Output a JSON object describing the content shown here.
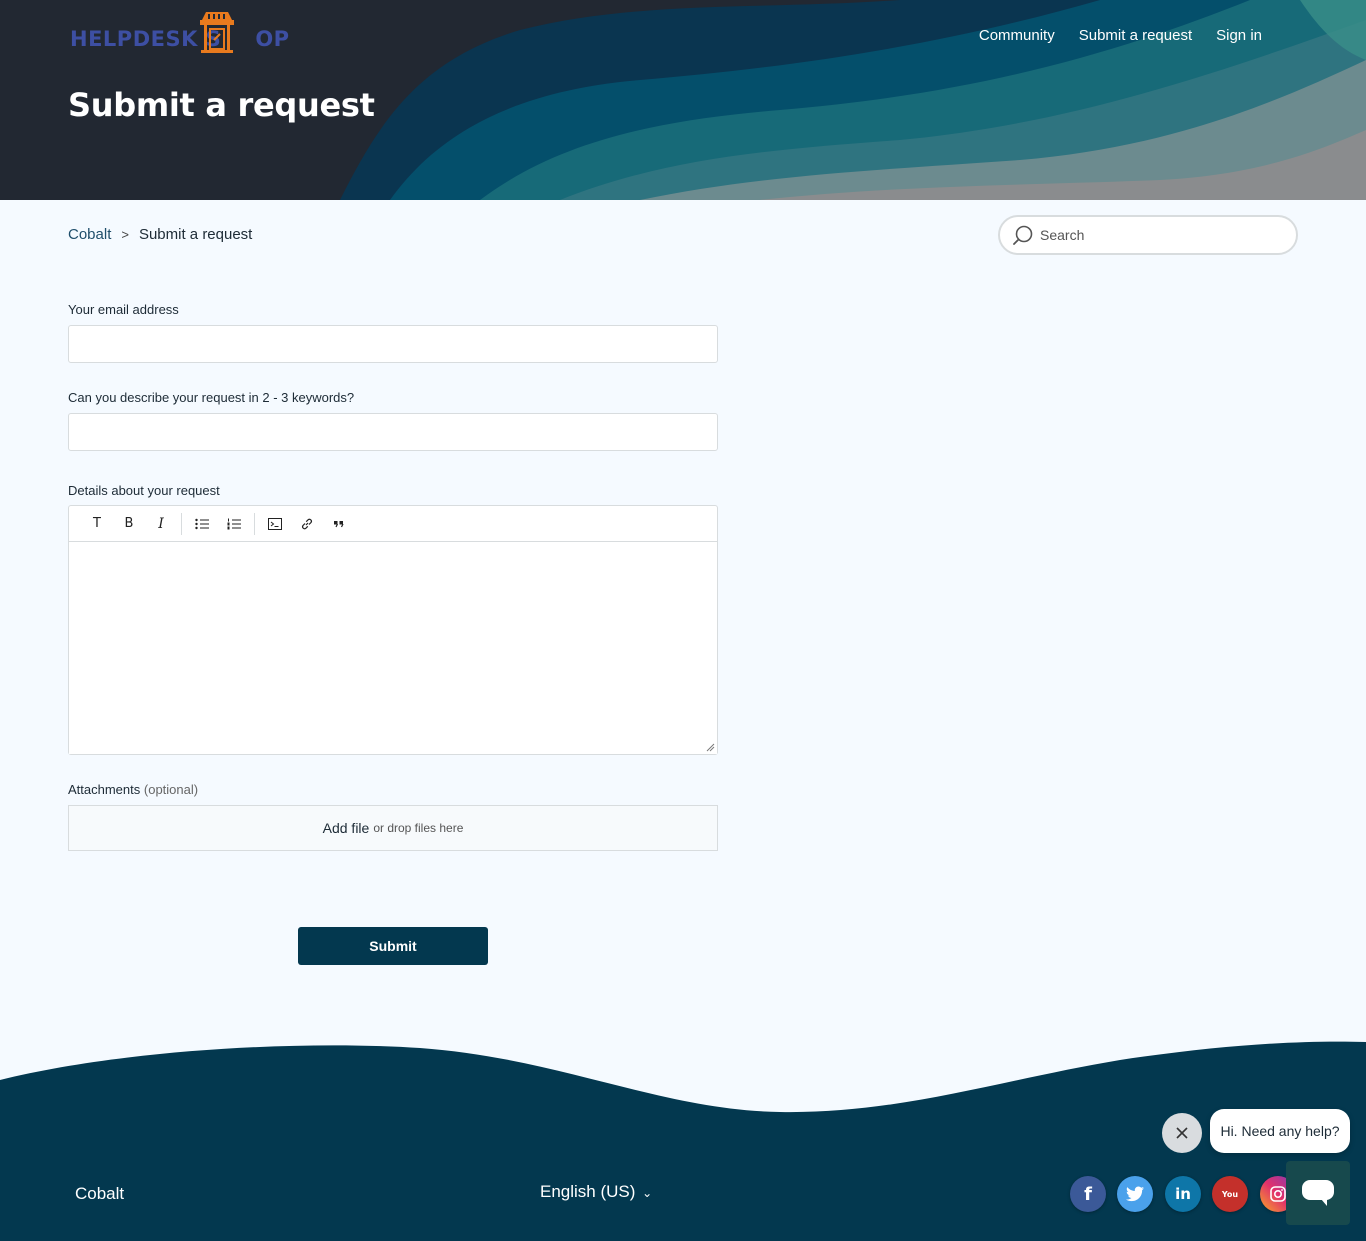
{
  "header": {
    "logo_text_left": "HELPDESK S",
    "logo_text_right": "OP",
    "nav": [
      "Community",
      "Submit a request",
      "Sign in"
    ],
    "title": "Submit a request"
  },
  "breadcrumb": {
    "root": "Cobalt",
    "separator": ">",
    "current": "Submit a request"
  },
  "search": {
    "placeholder": "Search"
  },
  "form": {
    "email_label": "Your email address",
    "email_value": "",
    "keywords_label": "Can you describe your request in 2 - 3 keywords?",
    "keywords_value": "",
    "details_label": "Details about your request",
    "toolbar": {
      "text": "T",
      "bold": "B",
      "italic": "I"
    },
    "attachments_label": "Attachments",
    "attachments_optional": "(optional)",
    "add_file": "Add file",
    "drop_text": "or drop files here",
    "submit": "Submit"
  },
  "footer": {
    "brand": "Cobalt",
    "language": "English (US)",
    "language_chevron": "⌄",
    "social": [
      {
        "name": "facebook-icon",
        "glyph": "f",
        "color": "#3b5998"
      },
      {
        "name": "twitter-icon",
        "glyph": "t",
        "color": "#4aa1eb"
      },
      {
        "name": "linkedin-icon",
        "glyph": "in",
        "color": "#0e76a8"
      },
      {
        "name": "youtube-icon",
        "glyph": "You",
        "color": "#c4302b"
      },
      {
        "name": "instagram-icon",
        "glyph": "◎",
        "color": "#e1306c"
      }
    ]
  },
  "chat": {
    "bubble": "Hi. Need any help?"
  },
  "colors": {
    "header_bg": "#222832",
    "footer_bg": "#03384f",
    "page_bg": "#f5faff",
    "button_bg": "#03384f",
    "link": "#1f4e6b",
    "logo_blue": "#3d4fa3",
    "logo_orange": "#e87a1e"
  }
}
